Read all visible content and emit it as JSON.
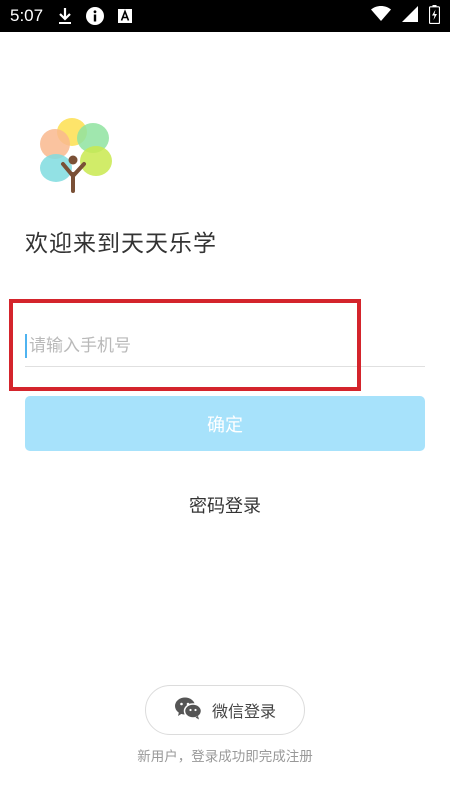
{
  "status_bar": {
    "time": "5:07",
    "left_icons": [
      "download-icon",
      "info-icon",
      "font-icon"
    ],
    "right_icons": [
      "wifi-icon",
      "signal-icon",
      "battery-icon"
    ]
  },
  "app": {
    "welcome_text": "欢迎来到天天乐学"
  },
  "login": {
    "phone_placeholder": "请输入手机号",
    "phone_value": "",
    "confirm_label": "确定",
    "password_login_label": "密码登录"
  },
  "wechat": {
    "label": "微信登录",
    "icon": "wechat-icon"
  },
  "footer": {
    "note": "新用户，登录成功即完成注册"
  },
  "colors": {
    "accent_button": "#a7e2fb",
    "highlight_border": "#d4242c",
    "cursor": "#4fb3f0"
  }
}
